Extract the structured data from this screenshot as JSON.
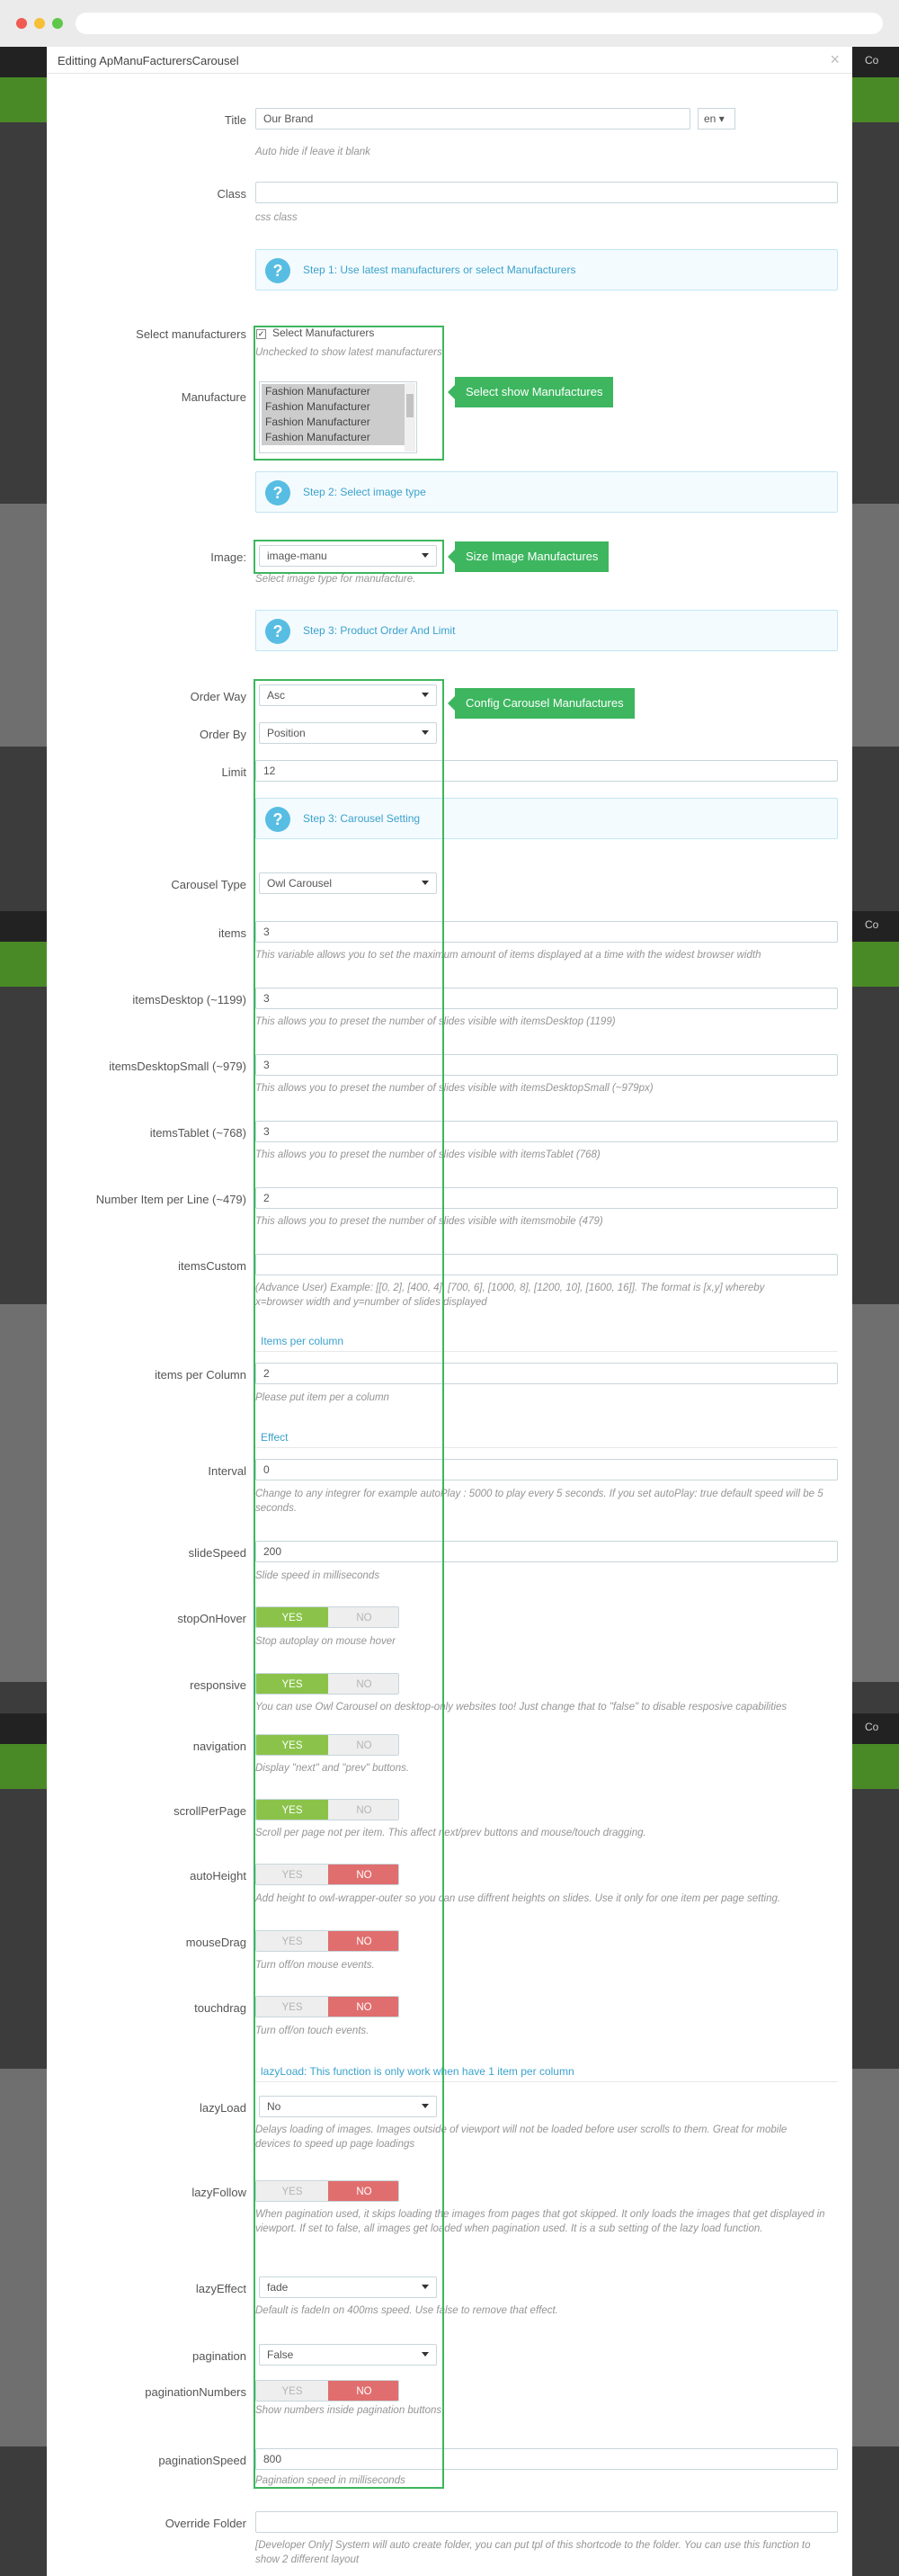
{
  "modal": {
    "title": "Editting ApManuFacturersCarousel",
    "close": "×"
  },
  "background": {
    "side_label": "Co"
  },
  "title_field": {
    "label": "Title",
    "value": "Our Brand",
    "lang": "en",
    "help": "Auto hide if leave it blank"
  },
  "class_field": {
    "label": "Class",
    "value": "",
    "help": "css class"
  },
  "step1": "Step 1: Use latest manufacturers or select Manufacturers",
  "select_manufacturers": {
    "label": "Select manufacturers",
    "checkbox_label": "Select Manufacturers",
    "help": "Unchecked to show latest manufacturers"
  },
  "manufacture": {
    "label": "Manufacture",
    "options": [
      "Fashion Manufacturer",
      "Fashion Manufacturer",
      "Fashion Manufacturer",
      "Fashion Manufacturer"
    ]
  },
  "step2": "Step 2: Select image type",
  "image": {
    "label": "Image:",
    "value": "image-manu",
    "help": "Select image type for manufacture."
  },
  "step3a": "Step 3: Product Order And Limit",
  "order_way": {
    "label": "Order Way",
    "value": "Asc"
  },
  "order_by": {
    "label": "Order By",
    "value": "Position"
  },
  "limit": {
    "label": "Limit",
    "value": "12"
  },
  "step3b": "Step 3: Carousel Setting",
  "carousel_type": {
    "label": "Carousel Type",
    "value": "Owl Carousel"
  },
  "items": {
    "label": "items",
    "value": "3",
    "help": "This variable allows you to set the maximum amount of items displayed at a time with the widest browser width"
  },
  "items_desktop": {
    "label": "itemsDesktop (~1199)",
    "value": "3",
    "help": "This allows you to preset the number of slides visible with itemsDesktop (1199)"
  },
  "items_desktop_small": {
    "label": "itemsDesktopSmall (~979)",
    "value": "3",
    "help": "This allows you to preset the number of slides visible with itemsDesktopSmall (~979px)"
  },
  "items_tablet": {
    "label": "itemsTablet (~768)",
    "value": "3",
    "help": "This allows you to preset the number of slides visible with itemsTablet (768)"
  },
  "items_mobile": {
    "label": "Number Item per Line (~479)",
    "value": "2",
    "help": "This allows you to preset the number of slides visible with itemsmobile (479)"
  },
  "items_custom": {
    "label": "itemsCustom",
    "value": "",
    "help": "(Advance User) Example: [[0, 2], [400, 4], [700, 6], [1000, 8], [1200, 10], [1600, 16]]. The format is [x,y] whereby x=browser width and y=number of slides displayed"
  },
  "section_items_per_column": "Items per column",
  "items_per_column": {
    "label": "items per Column",
    "value": "2",
    "help": "Please put item per a column"
  },
  "section_effect": "Effect",
  "interval": {
    "label": "Interval",
    "value": "0",
    "help": "Change to any integrer for example autoPlay : 5000 to play every 5 seconds. If you set autoPlay: true default speed will be 5 seconds."
  },
  "slide_speed": {
    "label": "slideSpeed",
    "value": "200",
    "help": "Slide speed in milliseconds"
  },
  "toggle_yes": "YES",
  "toggle_no": "NO",
  "stop_on_hover": {
    "label": "stopOnHover",
    "help": "Stop autoplay on mouse hover"
  },
  "responsive": {
    "label": "responsive",
    "help": "You can use Owl Carousel on desktop-only websites too! Just change that to \"false\" to disable resposive capabilities"
  },
  "navigation": {
    "label": "navigation",
    "help": "Display \"next\" and \"prev\" buttons."
  },
  "scroll_per_page": {
    "label": "scrollPerPage",
    "help": "Scroll per page not per item. This affect next/prev buttons and mouse/touch dragging."
  },
  "auto_height": {
    "label": "autoHeight",
    "help": "Add height to owl-wrapper-outer so you can use diffrent heights on slides. Use it only for one item per page setting."
  },
  "mouse_drag": {
    "label": "mouseDrag",
    "help": "Turn off/on mouse events."
  },
  "touch_drag": {
    "label": "touchdrag",
    "help": "Turn off/on touch events."
  },
  "section_lazy": "lazyLoad: This function is only work when have 1 item per column",
  "lazy_load": {
    "label": "lazyLoad",
    "value": "No",
    "help": "Delays loading of images. Images outside of viewport will not be loaded before user scrolls to them. Great for mobile devices to speed up page loadings"
  },
  "lazy_follow": {
    "label": "lazyFollow",
    "help": "When pagination used, it skips loading the images from pages that got skipped. It only loads the images that get displayed in viewport. If set to false, all images get loaded when pagination used. It is a sub setting of the lazy load function."
  },
  "lazy_effect": {
    "label": "lazyEffect",
    "value": "fade",
    "help": "Default is fadeIn on 400ms speed. Use false to remove that effect."
  },
  "pagination": {
    "label": "pagination",
    "value": "False"
  },
  "pagination_numbers": {
    "label": "paginationNumbers",
    "help": "Show numbers inside pagination buttons"
  },
  "pagination_speed": {
    "label": "paginationSpeed",
    "value": "800",
    "help": "Pagination speed in milliseconds"
  },
  "override_folder": {
    "label": "Override Folder",
    "value": "",
    "help": "[Developer Only] System will auto create folder, you can put tpl of this shortcode to the folder. You can use this function to show 2 different layout"
  },
  "annotations": {
    "select_show": "Select show Manufactures",
    "size_image": "Size Image Manufactures",
    "config_carousel": "Config Carousel Manufactures"
  },
  "colors": {
    "annotation_green": "#3db65f",
    "yes_green": "#8bc34a",
    "no_red": "#e16e6e",
    "info_blue": "#3aa2cc"
  }
}
